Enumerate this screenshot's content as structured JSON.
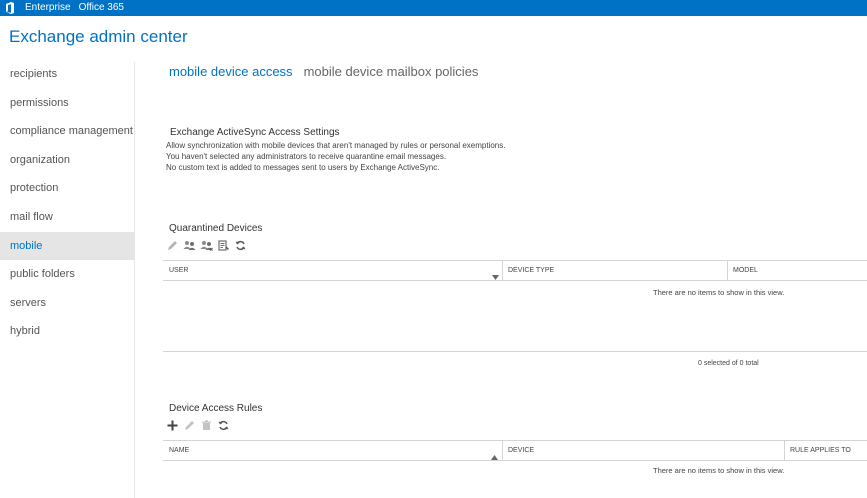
{
  "topbar": {
    "logo_icon": "office-logo-icon",
    "links": [
      "Enterprise",
      "Office 365"
    ]
  },
  "app": {
    "title": "Exchange admin center"
  },
  "nav": {
    "items": [
      "recipients",
      "permissions",
      "compliance management",
      "organization",
      "protection",
      "mail flow",
      "mobile",
      "public folders",
      "servers",
      "hybrid"
    ],
    "selected": "mobile"
  },
  "tabs": [
    {
      "label": "mobile device access",
      "active": true
    },
    {
      "label": "mobile device mailbox policies",
      "active": false
    }
  ],
  "eas": {
    "title": "Exchange ActiveSync Access Settings",
    "lines": [
      "Allow synchronization with mobile devices that aren't managed by rules or personal exemptions.",
      "You haven't selected any administrators to receive quarantine email messages.",
      "No custom text is added to messages sent to users by Exchange ActiveSync."
    ]
  },
  "quarantined": {
    "title": "Quarantined Devices",
    "toolbar_icons": [
      "edit-icon",
      "allow-users-icon",
      "block-users-icon",
      "details-icon",
      "refresh-icon"
    ],
    "columns": [
      "USER",
      "DEVICE TYPE",
      "MODEL"
    ],
    "empty_message": "There are no items to show in this view.",
    "count_text": "0 selected of 0 total"
  },
  "rules": {
    "title": "Device Access Rules",
    "toolbar_icons": [
      "add-icon",
      "edit-icon",
      "delete-icon",
      "refresh-icon"
    ],
    "columns": [
      "NAME",
      "DEVICE",
      "RULE APPLIES TO"
    ],
    "empty_message": "There are no items to show in this view."
  },
  "colors": {
    "brand": "#0072c6",
    "nav_selected_bg": "#e5e5e5",
    "border": "#d4d4d4"
  }
}
